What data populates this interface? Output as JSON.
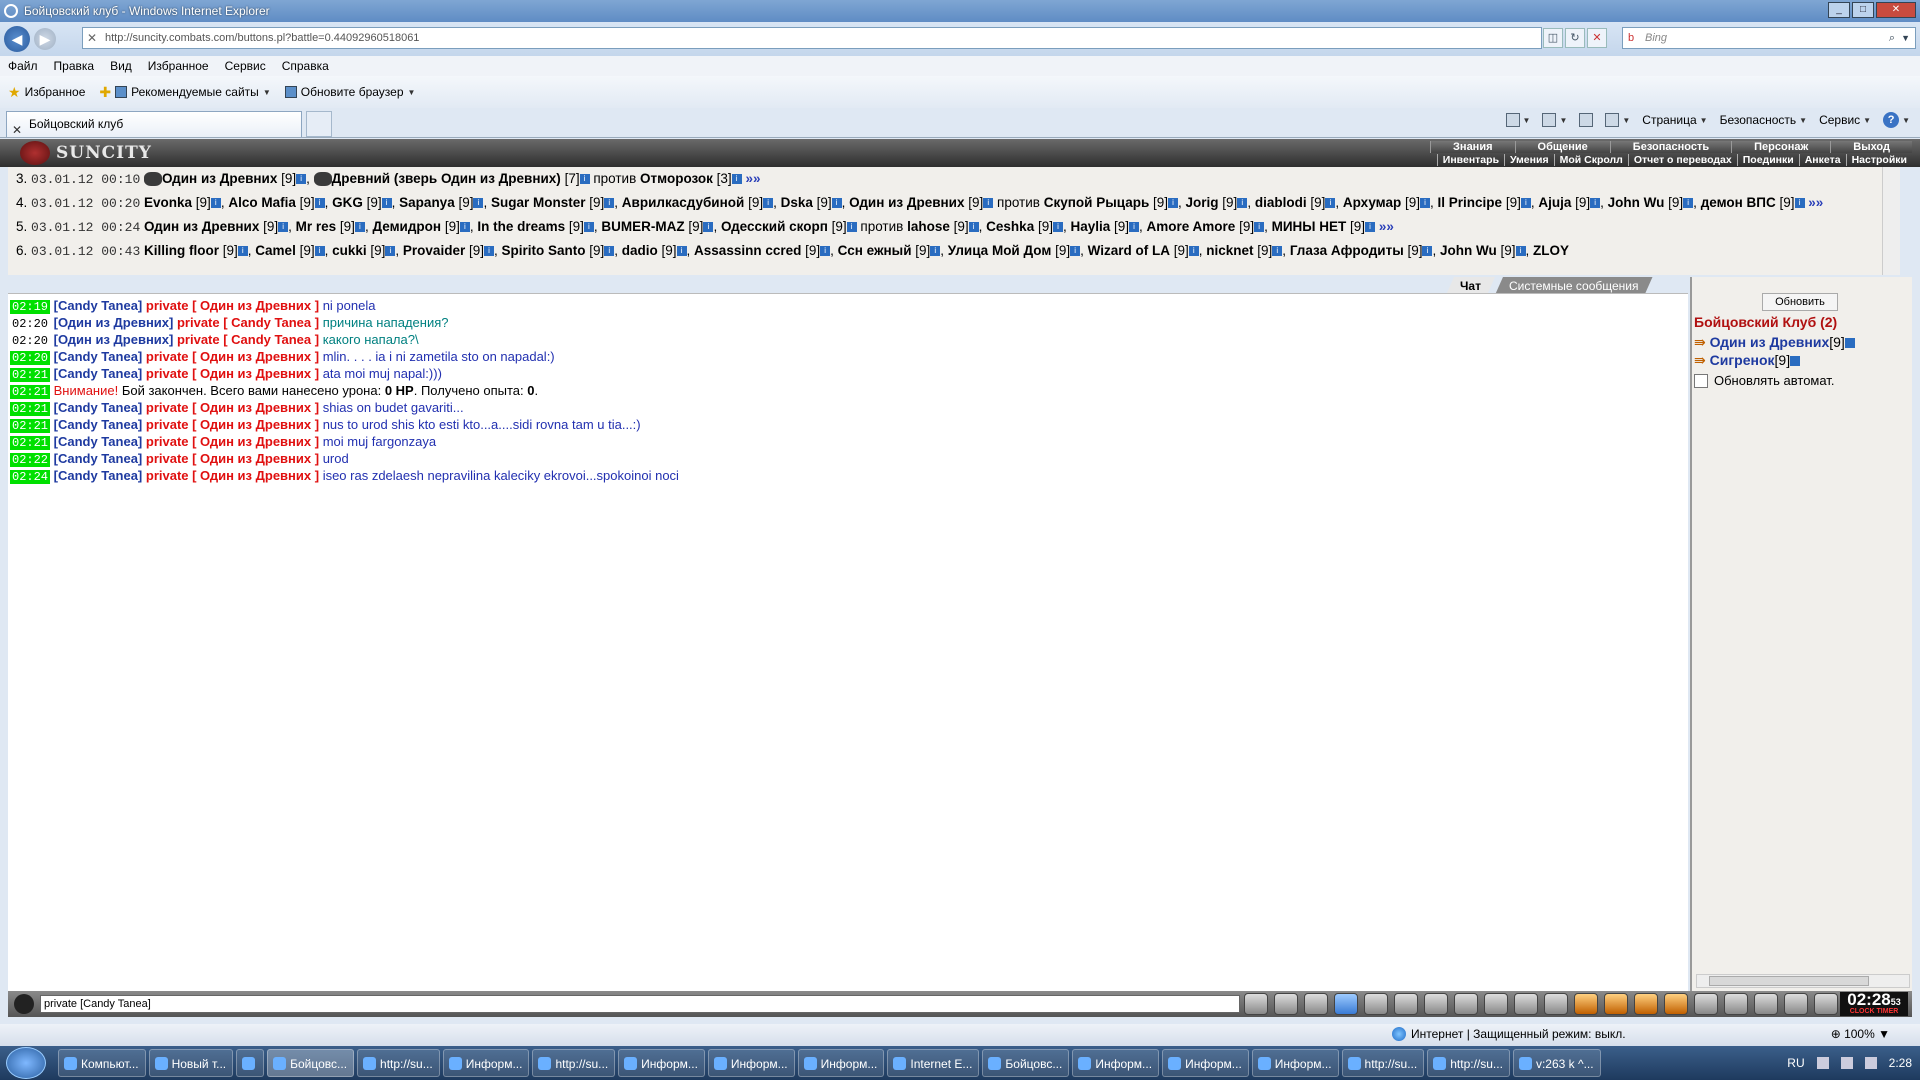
{
  "window": {
    "title": "Бойцовский клуб - Windows Internet Explorer",
    "url": "http://suncity.combats.com/buttons.pl?battle=0.44092960518061",
    "search_placeholder": "Bing"
  },
  "menu": [
    "Файл",
    "Правка",
    "Вид",
    "Избранное",
    "Сервис",
    "Справка"
  ],
  "favorites": {
    "favorites_label": "Избранное",
    "suggested_label": "Рекомендуемые сайты",
    "update_label": "Обновите браузер"
  },
  "tab": {
    "title": "Бойцовский клуб"
  },
  "commands": {
    "page": "Страница",
    "safety": "Безопасность",
    "tools": "Сервис"
  },
  "game": {
    "logo": "SUNCITY",
    "menu_top": [
      "Знания",
      "Общение",
      "Безопасность",
      "Персонаж",
      "Выход"
    ],
    "menu_bottom": [
      "Инвентарь",
      "Умения",
      "Мой Скролл",
      "Отчет о переводах",
      "Поединки",
      "Анкета",
      "Настройки"
    ]
  },
  "battles": [
    {
      "num": "3.",
      "date": "03.01.12 00:10",
      "a": "Один из Древних",
      "a_lvl": "[9]",
      "b": "Древний (зверь Один из Древних)",
      "b_lvl": "[7]",
      "vs": "против",
      "c": "Отморозок",
      "c_lvl": "[3]",
      "more": "»»"
    },
    {
      "num": "4.",
      "date": "03.01.12 00:20",
      "text1": "Evonka",
      "text2": "Alco Mafia",
      "text3": "GKG",
      "text4": "Sapanya",
      "text5": "Sugar Monster",
      "text6": "Аврилкасдубиной",
      "text7": "Dska",
      "text8": "Один из Древних",
      "vs": "против",
      "text9": "Скупой Рыцарь",
      "text10": "Jorig",
      "text11": "diablodi",
      "text12": "Архумар",
      "text13": "Il Principe",
      "text14": "Ajuja",
      "lvl_start": "[9]",
      "text15": "John Wu",
      "text16": "демон ВПС",
      "lvl": "[9]",
      "more": "»»"
    },
    {
      "num": "5.",
      "date": "03.01.12 00:24",
      "text1": "Один из Древних",
      "text2": "Mr res",
      "text3": "Демидрон",
      "text4": "In the dreams",
      "text5": "BUMER-MAZ",
      "text6": "Одесский скорп",
      "vs": "против",
      "text7": "lahose",
      "text8": "Ceshka",
      "text9": "Haylia",
      "text10": "Amore Amore",
      "text11": "МИНЫ НЕТ",
      "lvl": "[9]",
      "more": "»»"
    },
    {
      "num": "6.",
      "date": "03.01.12 00:43",
      "text1": "Killing floor",
      "text2": "Camel",
      "text3": "cukki",
      "text4": "Provaider",
      "text5": "Spirito Santo",
      "text6": "dadio",
      "text7": "Assassinn ccred",
      "text8": "Ссн ежный",
      "text9": "Улица Мой Дом",
      "text10": "Wizard of LA",
      "text11": "nicknet",
      "text12": "Глаза Афродиты",
      "text13": "John Wu",
      "text14": "ZLOY",
      "lvl": "[9]"
    }
  ],
  "chat_tabs": [
    "Чат",
    "Системные сообщения"
  ],
  "chat": [
    {
      "time": "02:19",
      "hl": true,
      "from": "[Candy Tanea]",
      "to": "private [ Один из Древних ]",
      "text": "ni ponela",
      "cls": "txt-blue"
    },
    {
      "time": "02:20",
      "hl": false,
      "from": "[Один из Древних]",
      "to": "private [ Candy Tanea ]",
      "text": "причина нападения?",
      "cls": "txt-teal"
    },
    {
      "time": "02:20",
      "hl": false,
      "from": "[Один из Древних]",
      "to": "private [ Candy Tanea ]",
      "text": "какого напала?\\",
      "cls": "txt-teal"
    },
    {
      "time": "02:20",
      "hl": true,
      "from": "[Candy Tanea]",
      "to": "private [ Один из Древних ]",
      "text": "mlin. . . . ia i ni zametila sto on napadal:)",
      "cls": "txt-blue"
    },
    {
      "time": "02:21",
      "hl": true,
      "from": "[Candy Tanea]",
      "to": "private [ Один из Древних ]",
      "text": "ata moi muj napal:)))",
      "cls": "txt-blue"
    },
    {
      "time": "02:21",
      "hl": true,
      "system": true,
      "warn": "Внимание!",
      "text1": " Бой закончен. Всего вами нанесено урона: ",
      "dmg": "0 HP",
      "text2": ". Получено опыта: ",
      "exp": "0",
      "text3": "."
    },
    {
      "time": "02:21",
      "hl": true,
      "from": "[Candy Tanea]",
      "to": "private [ Один из Древних ]",
      "text": "shias on budet gavariti...",
      "cls": "txt-blue"
    },
    {
      "time": "02:21",
      "hl": true,
      "from": "[Candy Tanea]",
      "to": "private [ Один из Древних ]",
      "text": "nus to urod shis kto esti kto...a....sidi rovna tam u tia...:)",
      "cls": "txt-blue"
    },
    {
      "time": "02:21",
      "hl": true,
      "from": "[Candy Tanea]",
      "to": "private [ Один из Древних ]",
      "text": "moi muj fargonzaya",
      "cls": "txt-blue"
    },
    {
      "time": "02:22",
      "hl": true,
      "from": "[Candy Tanea]",
      "to": "private [ Один из Древних ]",
      "text": "urod",
      "cls": "txt-blue"
    },
    {
      "time": "02:24",
      "hl": true,
      "from": "[Candy Tanea]",
      "to": "private [ Один из Древних ]",
      "text": "iseo ras zdelaesh nepravilina kaleciky ekrovoi...spokoinoi noci",
      "cls": "txt-blue"
    }
  ],
  "panel": {
    "refresh": "Обновить",
    "club": "Бойцовский Клуб (2)",
    "members": [
      {
        "name": "Один из Древних",
        "lvl": "[9]"
      },
      {
        "name": "Сигренок",
        "lvl": "[9]"
      }
    ],
    "auto": "Обновлять автомат."
  },
  "input": {
    "value": "private [Candy Tanea]"
  },
  "clock": {
    "time": "02:28",
    "sec": "53",
    "label": "CLOCK TIMER"
  },
  "status": {
    "zone": "Интернет | Защищенный режим: выкл.",
    "zoom": "100%"
  },
  "taskbar": {
    "tasks": [
      "Компьют...",
      "Новый т...",
      "",
      "Бойцовс...",
      "http://su...",
      "Информ...",
      "http://su...",
      "Информ...",
      "Информ...",
      "Информ...",
      "Internet E...",
      "Бойцовс...",
      "Информ...",
      "Информ...",
      "Информ...",
      "http://su...",
      "http://su...",
      "v:263 k ^..."
    ],
    "lang": "RU",
    "time": "2:28"
  }
}
